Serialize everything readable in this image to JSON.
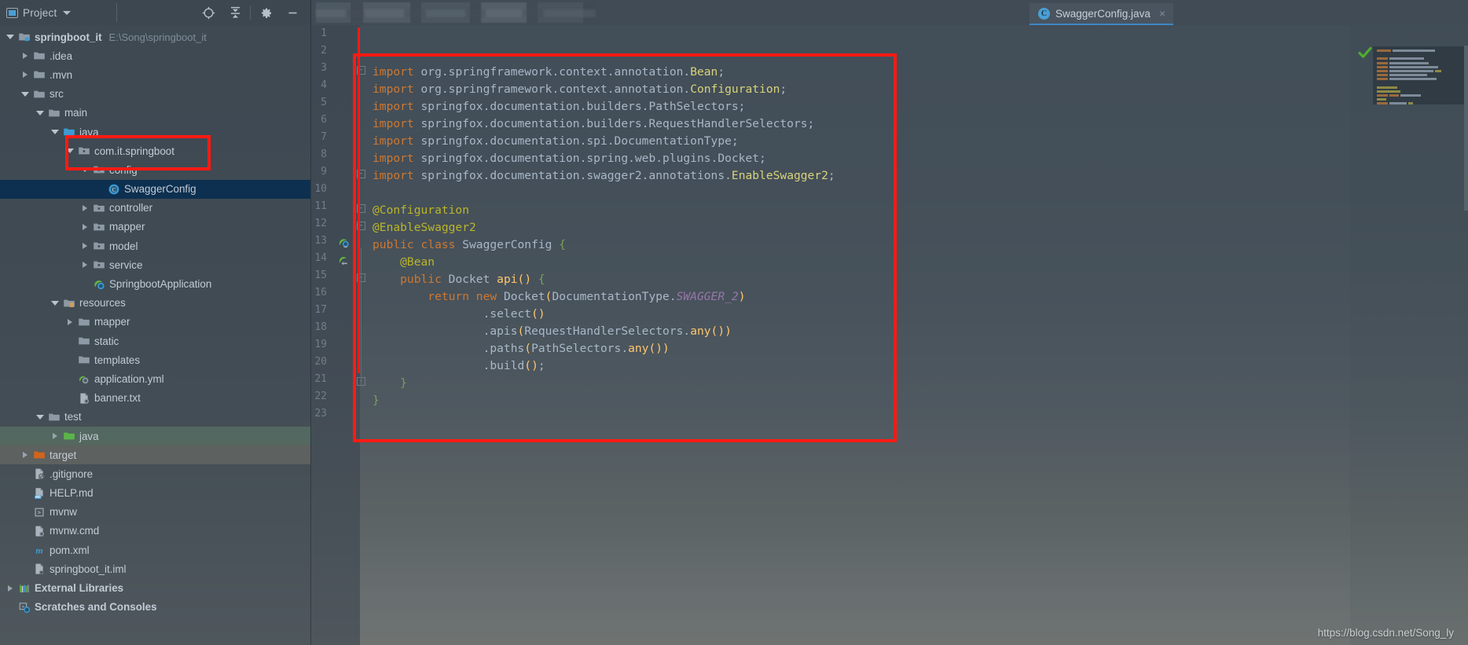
{
  "window": {
    "tool_window_title": "Project",
    "watermark": "https://blog.csdn.net/Song_ly"
  },
  "toolbar": {
    "locate_label": "Select Opened File",
    "collapse_label": "Collapse All",
    "settings_label": "Settings",
    "hide_label": "Hide"
  },
  "tabs": {
    "ghost_tabs_blurred": "",
    "active": {
      "label": "SwaggerConfig.java",
      "icon": "C",
      "close_label": "×",
      "underline_color": "#3d86c6"
    }
  },
  "sidebar": {
    "items": [
      {
        "label": "springboot_it",
        "sub": "E:\\Song\\springboot_it",
        "depth": 0,
        "arrow": "down",
        "icon": "module",
        "name": "project-root"
      },
      {
        "label": ".idea",
        "sub": "",
        "depth": 1,
        "arrow": "right",
        "icon": "folder",
        "name": "idea-folder"
      },
      {
        "label": ".mvn",
        "sub": "",
        "depth": 1,
        "arrow": "right",
        "icon": "folder",
        "name": "mvn-folder"
      },
      {
        "label": "src",
        "sub": "",
        "depth": 1,
        "arrow": "down",
        "icon": "folder",
        "name": "src-folder"
      },
      {
        "label": "main",
        "sub": "",
        "depth": 2,
        "arrow": "down",
        "icon": "folder",
        "name": "main-folder"
      },
      {
        "label": "java",
        "sub": "",
        "depth": 3,
        "arrow": "down",
        "icon": "folder-source",
        "name": "java-source-folder"
      },
      {
        "label": "com.it.springboot",
        "sub": "",
        "depth": 4,
        "arrow": "down",
        "icon": "package",
        "name": "package-com-it-springboot"
      },
      {
        "label": "config",
        "sub": "",
        "depth": 5,
        "arrow": "down",
        "icon": "package",
        "name": "package-config"
      },
      {
        "label": "SwaggerConfig",
        "sub": "",
        "depth": 6,
        "arrow": "none",
        "icon": "class",
        "name": "class-swaggerconfig",
        "selected": true
      },
      {
        "label": "controller",
        "sub": "",
        "depth": 5,
        "arrow": "right",
        "icon": "package",
        "name": "package-controller"
      },
      {
        "label": "mapper",
        "sub": "",
        "depth": 5,
        "arrow": "right",
        "icon": "package",
        "name": "package-mapper"
      },
      {
        "label": "model",
        "sub": "",
        "depth": 5,
        "arrow": "right",
        "icon": "package",
        "name": "package-model"
      },
      {
        "label": "service",
        "sub": "",
        "depth": 5,
        "arrow": "right",
        "icon": "package",
        "name": "package-service"
      },
      {
        "label": "SpringbootApplication",
        "sub": "",
        "depth": 5,
        "arrow": "none",
        "icon": "spring-class",
        "name": "class-springbootapplication"
      },
      {
        "label": "resources",
        "sub": "",
        "depth": 3,
        "arrow": "down",
        "icon": "folder-resources",
        "name": "resources-folder"
      },
      {
        "label": "mapper",
        "sub": "",
        "depth": 4,
        "arrow": "right",
        "icon": "folder",
        "name": "resources-mapper-folder"
      },
      {
        "label": "static",
        "sub": "",
        "depth": 4,
        "arrow": "none",
        "icon": "folder",
        "name": "static-folder"
      },
      {
        "label": "templates",
        "sub": "",
        "depth": 4,
        "arrow": "none",
        "icon": "folder",
        "name": "templates-folder"
      },
      {
        "label": "application.yml",
        "sub": "",
        "depth": 4,
        "arrow": "none",
        "icon": "yml",
        "name": "file-application-yml"
      },
      {
        "label": "banner.txt",
        "sub": "",
        "depth": 4,
        "arrow": "none",
        "icon": "txt",
        "name": "file-banner-txt"
      },
      {
        "label": "test",
        "sub": "",
        "depth": 2,
        "arrow": "down",
        "icon": "folder",
        "name": "test-folder"
      },
      {
        "label": "java",
        "sub": "",
        "depth": 3,
        "arrow": "right",
        "icon": "folder-test",
        "name": "test-java-folder",
        "rowhl": "test"
      },
      {
        "label": "target",
        "sub": "",
        "depth": 1,
        "arrow": "right",
        "icon": "folder-target",
        "name": "target-folder",
        "rowhl": "target"
      },
      {
        "label": ".gitignore",
        "sub": "",
        "depth": 1,
        "arrow": "none",
        "icon": "gitignore",
        "name": "file-gitignore"
      },
      {
        "label": "HELP.md",
        "sub": "",
        "depth": 1,
        "arrow": "none",
        "icon": "md",
        "name": "file-help-md"
      },
      {
        "label": "mvnw",
        "sub": "",
        "depth": 1,
        "arrow": "none",
        "icon": "script",
        "name": "file-mvnw"
      },
      {
        "label": "mvnw.cmd",
        "sub": "",
        "depth": 1,
        "arrow": "none",
        "icon": "txt",
        "name": "file-mvnw-cmd"
      },
      {
        "label": "pom.xml",
        "sub": "",
        "depth": 1,
        "arrow": "none",
        "icon": "maven",
        "name": "file-pom-xml"
      },
      {
        "label": "springboot_it.iml",
        "sub": "",
        "depth": 1,
        "arrow": "none",
        "icon": "iml",
        "name": "file-iml"
      },
      {
        "label": "External Libraries",
        "sub": "",
        "depth": 0,
        "arrow": "right",
        "icon": "libraries",
        "name": "external-libraries"
      },
      {
        "label": "Scratches and Consoles",
        "sub": "",
        "depth": 0,
        "arrow": "none",
        "icon": "scratches",
        "name": "scratches-and-consoles"
      }
    ]
  },
  "editor": {
    "line_numbers": [
      1,
      2,
      3,
      4,
      5,
      6,
      7,
      8,
      9,
      10,
      11,
      12,
      13,
      14,
      15,
      16,
      17,
      18,
      19,
      20,
      21,
      22,
      23
    ],
    "code_lines": [
      {
        "n": 1,
        "tokens": []
      },
      {
        "n": 2,
        "tokens": []
      },
      {
        "n": 3,
        "tokens": [
          {
            "t": "import ",
            "c": "kw"
          },
          {
            "t": "org.springframework.context.annotation.",
            "c": "pl"
          },
          {
            "t": "Bean",
            "c": "cls"
          },
          {
            "t": ";",
            "c": "pl"
          }
        ]
      },
      {
        "n": 4,
        "tokens": [
          {
            "t": "import ",
            "c": "kw"
          },
          {
            "t": "org.springframework.context.annotation.",
            "c": "pl"
          },
          {
            "t": "Configuration",
            "c": "cls"
          },
          {
            "t": ";",
            "c": "pl"
          }
        ]
      },
      {
        "n": 5,
        "tokens": [
          {
            "t": "import ",
            "c": "kw"
          },
          {
            "t": "springfox.documentation.builders.PathSelectors;",
            "c": "pl"
          }
        ]
      },
      {
        "n": 6,
        "tokens": [
          {
            "t": "import ",
            "c": "kw"
          },
          {
            "t": "springfox.documentation.builders.RequestHandlerSelectors;",
            "c": "pl"
          }
        ]
      },
      {
        "n": 7,
        "tokens": [
          {
            "t": "import ",
            "c": "kw"
          },
          {
            "t": "springfox.documentation.spi.DocumentationType;",
            "c": "pl"
          }
        ]
      },
      {
        "n": 8,
        "tokens": [
          {
            "t": "import ",
            "c": "kw"
          },
          {
            "t": "springfox.documentation.spring.web.plugins.Docket;",
            "c": "pl"
          }
        ]
      },
      {
        "n": 9,
        "tokens": [
          {
            "t": "import ",
            "c": "kw"
          },
          {
            "t": "springfox.documentation.swagger2.annotations.",
            "c": "pl"
          },
          {
            "t": "EnableSwagger2",
            "c": "cls"
          },
          {
            "t": ";",
            "c": "pl"
          }
        ]
      },
      {
        "n": 10,
        "tokens": []
      },
      {
        "n": 11,
        "tokens": [
          {
            "t": "@Configuration",
            "c": "anno"
          }
        ]
      },
      {
        "n": 12,
        "tokens": [
          {
            "t": "@EnableSwagger2",
            "c": "anno"
          }
        ]
      },
      {
        "n": 13,
        "tokens": [
          {
            "t": "public class ",
            "c": "kw"
          },
          {
            "t": "SwaggerConfig ",
            "c": "pl"
          },
          {
            "t": "{",
            "c": "brg"
          }
        ]
      },
      {
        "n": 14,
        "tokens": [
          {
            "t": "    @Bean",
            "c": "anno"
          }
        ]
      },
      {
        "n": 15,
        "tokens": [
          {
            "t": "    public ",
            "c": "kw"
          },
          {
            "t": "Docket ",
            "c": "pl"
          },
          {
            "t": "api",
            "c": "mth"
          },
          {
            "t": "()",
            "c": "mth"
          },
          {
            "t": " ",
            "c": "pl"
          },
          {
            "t": "{",
            "c": "brg"
          }
        ]
      },
      {
        "n": 16,
        "tokens": [
          {
            "t": "        return new ",
            "c": "kw"
          },
          {
            "t": "Docket",
            "c": "pl"
          },
          {
            "t": "(",
            "c": "mth"
          },
          {
            "t": "DocumentationType.",
            "c": "pl"
          },
          {
            "t": "SWAGGER_2",
            "c": "stat"
          },
          {
            "t": ")",
            "c": "mth"
          }
        ]
      },
      {
        "n": 17,
        "tokens": [
          {
            "t": "                .select",
            "c": "pl"
          },
          {
            "t": "()",
            "c": "mth"
          }
        ]
      },
      {
        "n": 18,
        "tokens": [
          {
            "t": "                .apis",
            "c": "pl"
          },
          {
            "t": "(",
            "c": "mth"
          },
          {
            "t": "RequestHandlerSelectors.",
            "c": "pl"
          },
          {
            "t": "any",
            "c": "mth"
          },
          {
            "t": "()",
            "c": "mth"
          },
          {
            "t": ")",
            "c": "mth"
          }
        ]
      },
      {
        "n": 19,
        "tokens": [
          {
            "t": "                .paths",
            "c": "pl"
          },
          {
            "t": "(",
            "c": "mth"
          },
          {
            "t": "PathSelectors.",
            "c": "pl"
          },
          {
            "t": "any",
            "c": "mth"
          },
          {
            "t": "()",
            "c": "mth"
          },
          {
            "t": ")",
            "c": "mth"
          }
        ]
      },
      {
        "n": 20,
        "tokens": [
          {
            "t": "                .build",
            "c": "pl"
          },
          {
            "t": "()",
            "c": "mth"
          },
          {
            "t": ";",
            "c": "pl"
          }
        ]
      },
      {
        "n": 21,
        "tokens": [
          {
            "t": "    ",
            "c": "pl"
          },
          {
            "t": "}",
            "c": "brg"
          }
        ]
      },
      {
        "n": 22,
        "tokens": [
          {
            "t": "}",
            "c": "brg"
          }
        ]
      },
      {
        "n": 23,
        "tokens": []
      }
    ],
    "gutter_icons": [
      {
        "line": 13,
        "name": "spring-bean-gutter-icon"
      },
      {
        "line": 14,
        "name": "spring-bean-navigate-gutter-icon"
      }
    ],
    "status": {
      "inspection": "ok",
      "check_color": "#4caf2f"
    }
  },
  "annotations": {
    "tree_highlight_color": "#ff1a13",
    "code_highlight_color": "#ff1a13"
  },
  "colors": {
    "keyword": "#cc7832",
    "plain": "#a9b7c6",
    "annotation": "#bbb529",
    "method": "#ffc66d",
    "static_field": "#9876aa",
    "selection": "#0d3050",
    "accent": "#4a9fd4"
  }
}
